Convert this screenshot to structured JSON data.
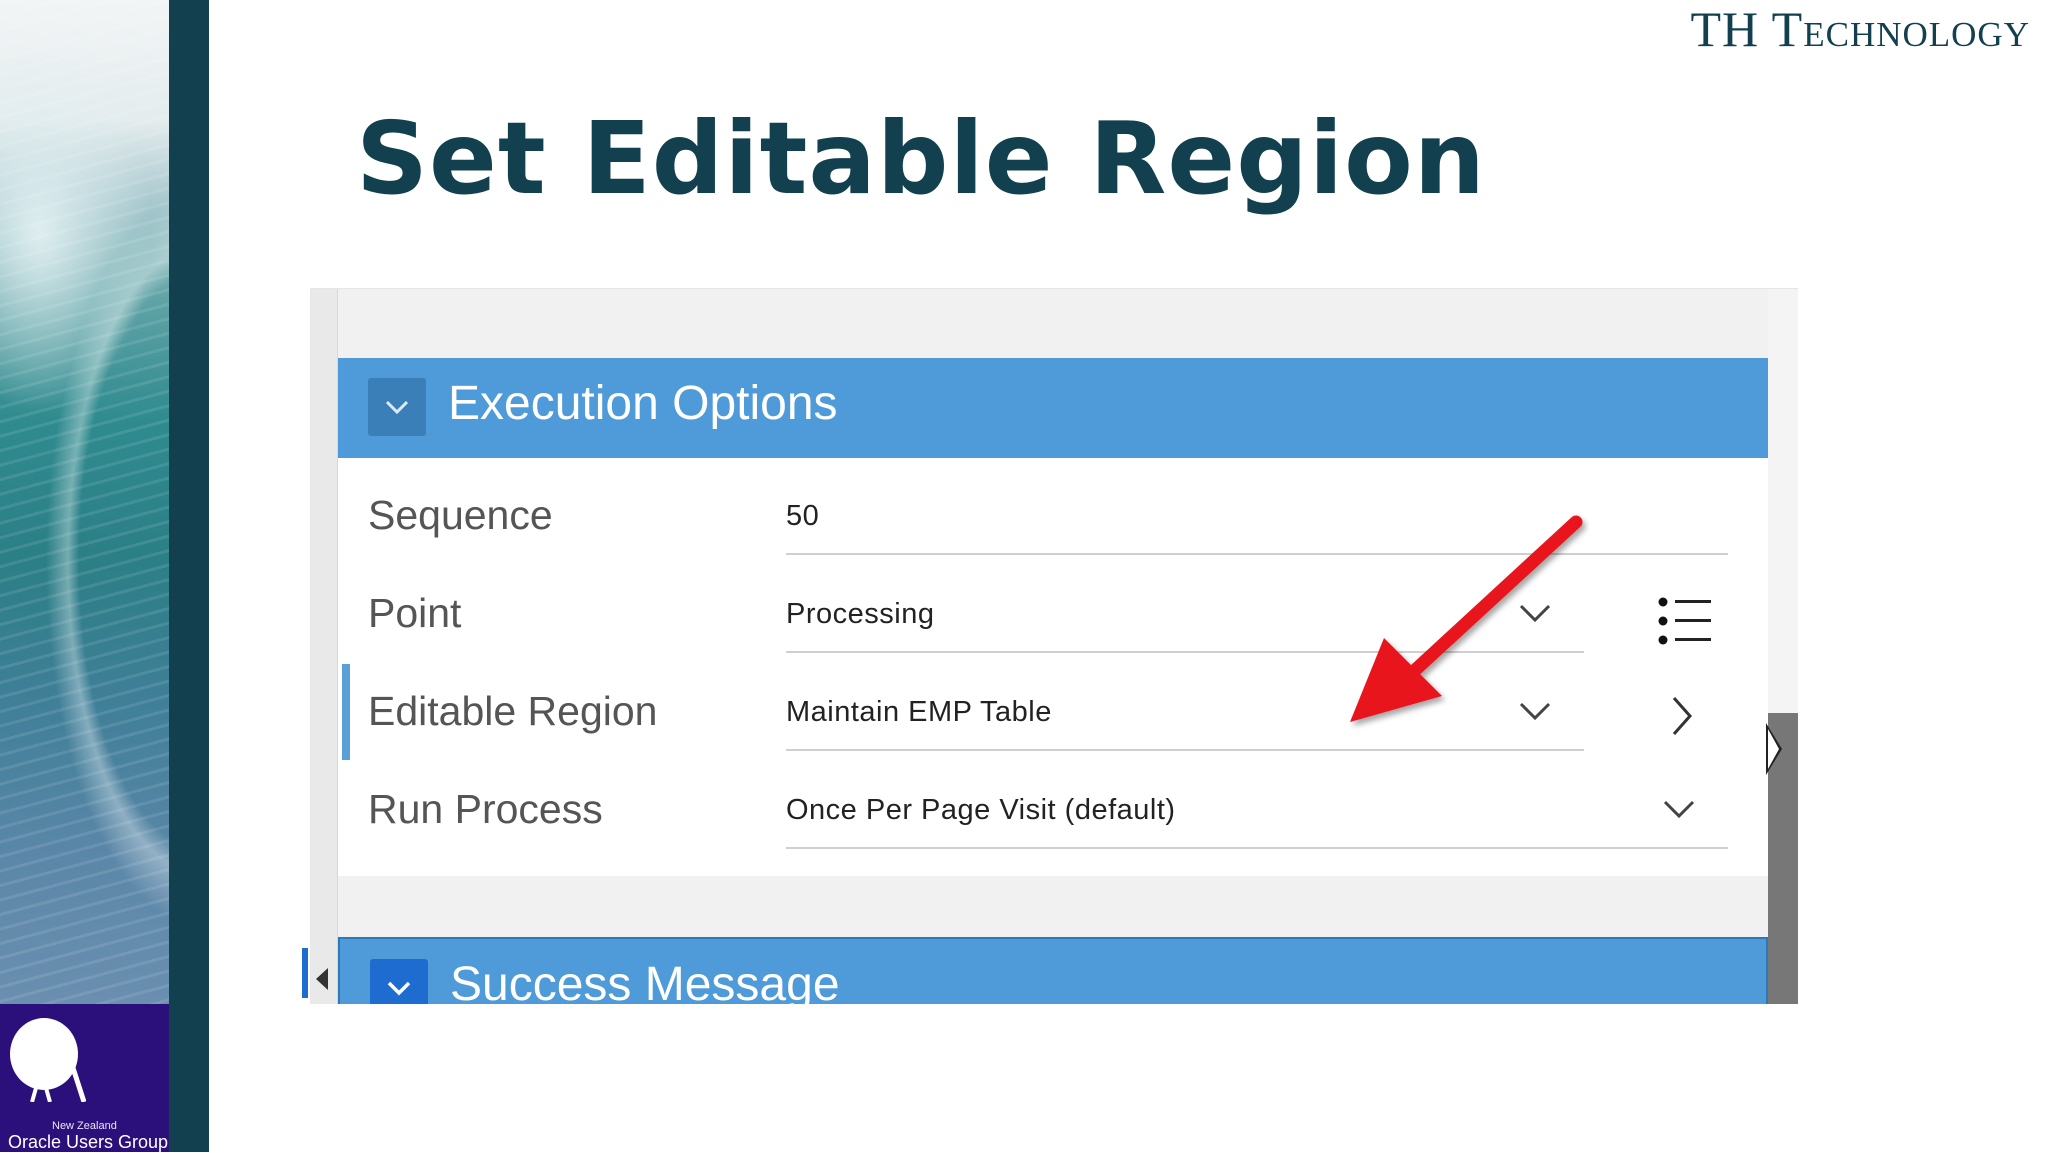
{
  "slide": {
    "brand": "TH Technology",
    "title": "Set Editable Region",
    "logo": {
      "small_text": "New Zealand",
      "big_text": "Oracle Users Group"
    }
  },
  "panel": {
    "execution_section": {
      "title": "Execution Options",
      "icon": "chevron-down-icon"
    },
    "fields": [
      {
        "label": "Sequence",
        "value": "50"
      },
      {
        "label": "Point",
        "value": "Processing"
      },
      {
        "label": "Editable Region",
        "value": "Maintain EMP Table"
      },
      {
        "label": "Run Process",
        "value": "Once Per Page Visit (default)"
      }
    ],
    "success_section": {
      "title": "Success Message",
      "icon": "chevron-down-icon"
    }
  },
  "colors": {
    "accent_dark": "#12404f",
    "section_blue": "#4f9ad8",
    "annotation_arrow": "#e8141b",
    "logo_purple": "#2b0f7a"
  }
}
